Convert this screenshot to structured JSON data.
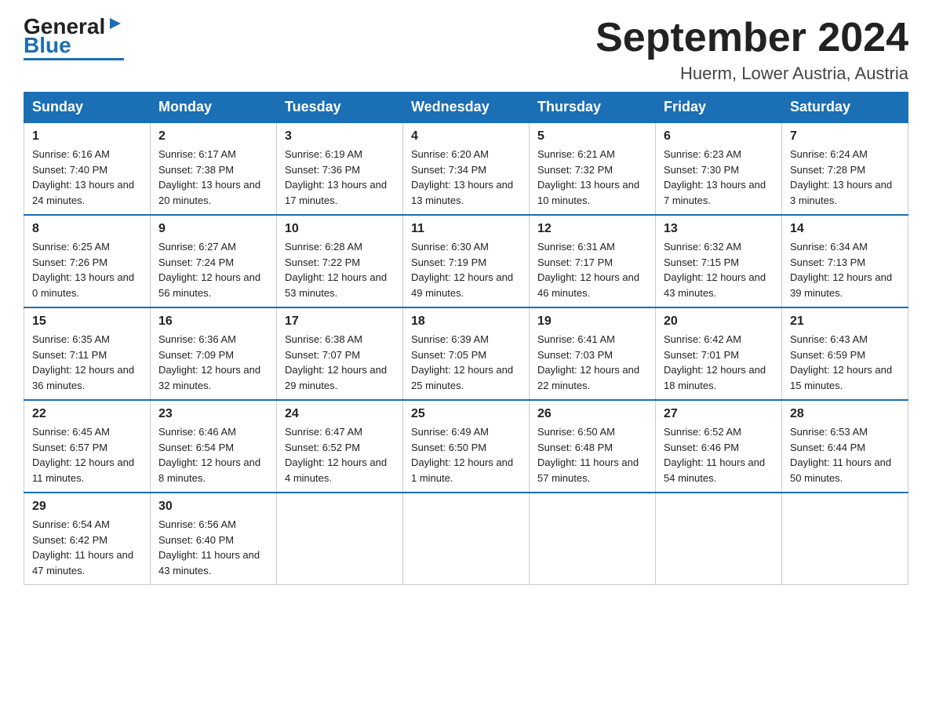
{
  "logo": {
    "general": "General",
    "blue": "Blue",
    "triangle": "▶"
  },
  "title": "September 2024",
  "location": "Huerm, Lower Austria, Austria",
  "days_of_week": [
    "Sunday",
    "Monday",
    "Tuesday",
    "Wednesday",
    "Thursday",
    "Friday",
    "Saturday"
  ],
  "weeks": [
    [
      {
        "day": "1",
        "sunrise": "6:16 AM",
        "sunset": "7:40 PM",
        "daylight": "13 hours and 24 minutes."
      },
      {
        "day": "2",
        "sunrise": "6:17 AM",
        "sunset": "7:38 PM",
        "daylight": "13 hours and 20 minutes."
      },
      {
        "day": "3",
        "sunrise": "6:19 AM",
        "sunset": "7:36 PM",
        "daylight": "13 hours and 17 minutes."
      },
      {
        "day": "4",
        "sunrise": "6:20 AM",
        "sunset": "7:34 PM",
        "daylight": "13 hours and 13 minutes."
      },
      {
        "day": "5",
        "sunrise": "6:21 AM",
        "sunset": "7:32 PM",
        "daylight": "13 hours and 10 minutes."
      },
      {
        "day": "6",
        "sunrise": "6:23 AM",
        "sunset": "7:30 PM",
        "daylight": "13 hours and 7 minutes."
      },
      {
        "day": "7",
        "sunrise": "6:24 AM",
        "sunset": "7:28 PM",
        "daylight": "13 hours and 3 minutes."
      }
    ],
    [
      {
        "day": "8",
        "sunrise": "6:25 AM",
        "sunset": "7:26 PM",
        "daylight": "13 hours and 0 minutes."
      },
      {
        "day": "9",
        "sunrise": "6:27 AM",
        "sunset": "7:24 PM",
        "daylight": "12 hours and 56 minutes."
      },
      {
        "day": "10",
        "sunrise": "6:28 AM",
        "sunset": "7:22 PM",
        "daylight": "12 hours and 53 minutes."
      },
      {
        "day": "11",
        "sunrise": "6:30 AM",
        "sunset": "7:19 PM",
        "daylight": "12 hours and 49 minutes."
      },
      {
        "day": "12",
        "sunrise": "6:31 AM",
        "sunset": "7:17 PM",
        "daylight": "12 hours and 46 minutes."
      },
      {
        "day": "13",
        "sunrise": "6:32 AM",
        "sunset": "7:15 PM",
        "daylight": "12 hours and 43 minutes."
      },
      {
        "day": "14",
        "sunrise": "6:34 AM",
        "sunset": "7:13 PM",
        "daylight": "12 hours and 39 minutes."
      }
    ],
    [
      {
        "day": "15",
        "sunrise": "6:35 AM",
        "sunset": "7:11 PM",
        "daylight": "12 hours and 36 minutes."
      },
      {
        "day": "16",
        "sunrise": "6:36 AM",
        "sunset": "7:09 PM",
        "daylight": "12 hours and 32 minutes."
      },
      {
        "day": "17",
        "sunrise": "6:38 AM",
        "sunset": "7:07 PM",
        "daylight": "12 hours and 29 minutes."
      },
      {
        "day": "18",
        "sunrise": "6:39 AM",
        "sunset": "7:05 PM",
        "daylight": "12 hours and 25 minutes."
      },
      {
        "day": "19",
        "sunrise": "6:41 AM",
        "sunset": "7:03 PM",
        "daylight": "12 hours and 22 minutes."
      },
      {
        "day": "20",
        "sunrise": "6:42 AM",
        "sunset": "7:01 PM",
        "daylight": "12 hours and 18 minutes."
      },
      {
        "day": "21",
        "sunrise": "6:43 AM",
        "sunset": "6:59 PM",
        "daylight": "12 hours and 15 minutes."
      }
    ],
    [
      {
        "day": "22",
        "sunrise": "6:45 AM",
        "sunset": "6:57 PM",
        "daylight": "12 hours and 11 minutes."
      },
      {
        "day": "23",
        "sunrise": "6:46 AM",
        "sunset": "6:54 PM",
        "daylight": "12 hours and 8 minutes."
      },
      {
        "day": "24",
        "sunrise": "6:47 AM",
        "sunset": "6:52 PM",
        "daylight": "12 hours and 4 minutes."
      },
      {
        "day": "25",
        "sunrise": "6:49 AM",
        "sunset": "6:50 PM",
        "daylight": "12 hours and 1 minute."
      },
      {
        "day": "26",
        "sunrise": "6:50 AM",
        "sunset": "6:48 PM",
        "daylight": "11 hours and 57 minutes."
      },
      {
        "day": "27",
        "sunrise": "6:52 AM",
        "sunset": "6:46 PM",
        "daylight": "11 hours and 54 minutes."
      },
      {
        "day": "28",
        "sunrise": "6:53 AM",
        "sunset": "6:44 PM",
        "daylight": "11 hours and 50 minutes."
      }
    ],
    [
      {
        "day": "29",
        "sunrise": "6:54 AM",
        "sunset": "6:42 PM",
        "daylight": "11 hours and 47 minutes."
      },
      {
        "day": "30",
        "sunrise": "6:56 AM",
        "sunset": "6:40 PM",
        "daylight": "11 hours and 43 minutes."
      },
      null,
      null,
      null,
      null,
      null
    ]
  ]
}
